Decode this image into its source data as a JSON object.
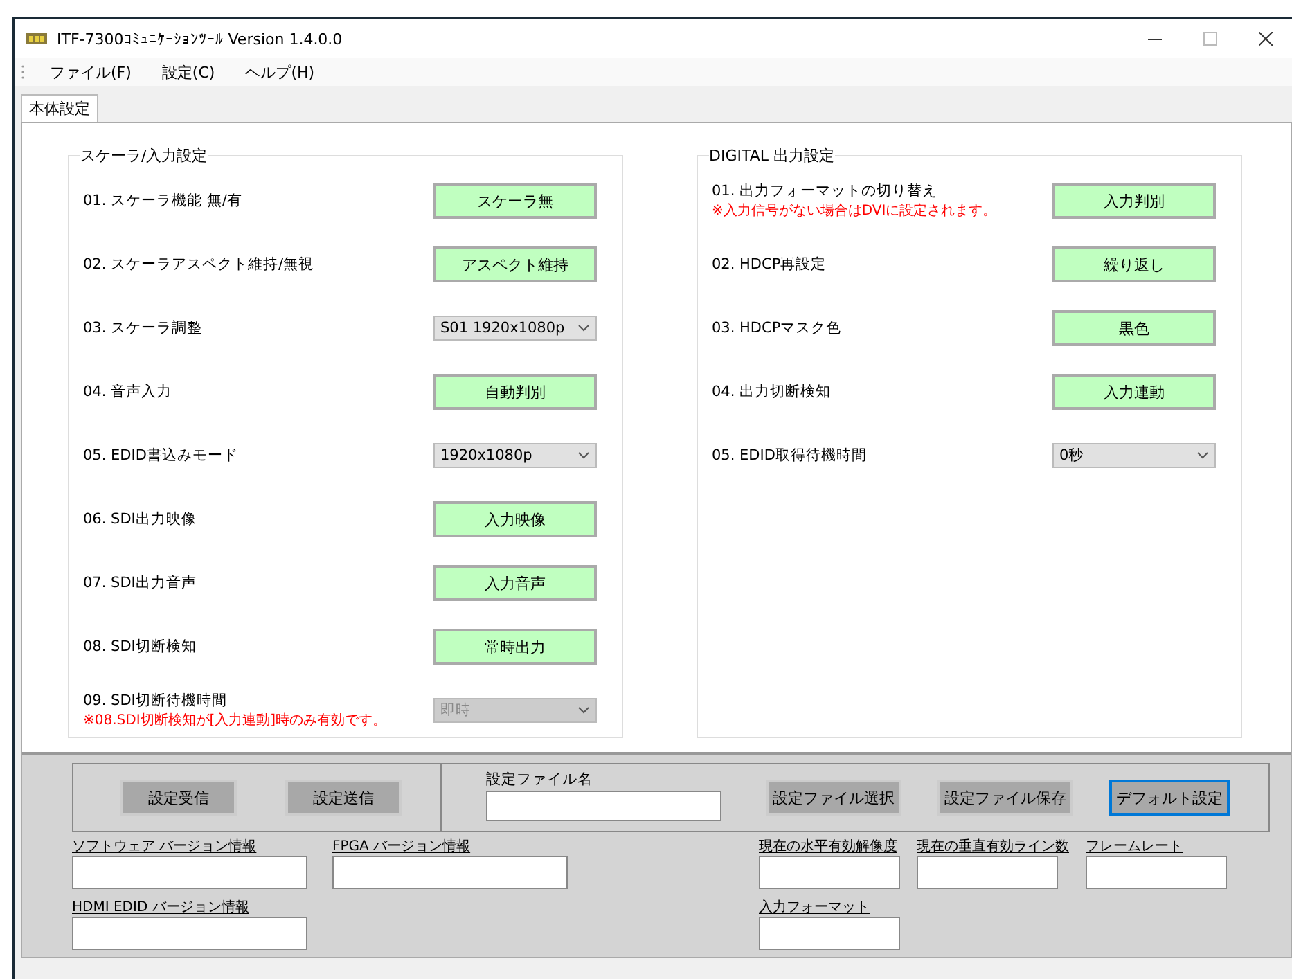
{
  "window": {
    "title": "ITF-7300ｺﾐｭﾆｹｰｼｮﾝﾂｰﾙ Version 1.4.0.0"
  },
  "menu": [
    {
      "label": "ファイル(F)"
    },
    {
      "label": "設定(C)"
    },
    {
      "label": "ヘルプ(H)"
    }
  ],
  "tabs": [
    {
      "label": "本体設定",
      "selected": true
    }
  ],
  "groups": [
    {
      "title": "スケーラ/入力設定",
      "rows": [
        {
          "label": "01. スケーラ機能 無/有",
          "control": {
            "kind": "button",
            "value": "スケーラ無"
          }
        },
        {
          "label": "02. スケーラアスペクト維持/無視",
          "control": {
            "kind": "button",
            "value": "アスペクト維持"
          }
        },
        {
          "label": "03. スケーラ調整",
          "control": {
            "kind": "dropdown",
            "value": "S01 1920x1080p",
            "disabled": false
          }
        },
        {
          "label": "04. 音声入力",
          "control": {
            "kind": "button",
            "value": "自動判別"
          }
        },
        {
          "label": "05. EDID書込みモード",
          "control": {
            "kind": "dropdown",
            "value": "1920x1080p",
            "disabled": false
          }
        },
        {
          "label": "06. SDI出力映像",
          "control": {
            "kind": "button",
            "value": "入力映像"
          }
        },
        {
          "label": "07. SDI出力音声",
          "control": {
            "kind": "button",
            "value": "入力音声"
          }
        },
        {
          "label": "08. SDI切断検知",
          "control": {
            "kind": "button",
            "value": "常時出力"
          }
        },
        {
          "label": "09. SDI切断待機時間",
          "note": "※08.SDI切断検知が[入力連動]時のみ有効です。",
          "control": {
            "kind": "dropdown",
            "value": "即時",
            "disabled": true
          }
        }
      ]
    },
    {
      "title": "DIGITAL 出力設定",
      "rows": [
        {
          "label": "01. 出力フォーマットの切り替え",
          "note": "※入力信号がない場合はDVIに設定されます。",
          "control": {
            "kind": "button",
            "value": "入力判別"
          }
        },
        {
          "label": "02. HDCP再設定",
          "control": {
            "kind": "button",
            "value": "繰り返し"
          }
        },
        {
          "label": "03. HDCPマスク色",
          "control": {
            "kind": "button",
            "value": "黒色"
          }
        },
        {
          "label": "04. 出力切断検知",
          "control": {
            "kind": "button",
            "value": "入力連動"
          }
        },
        {
          "label": "05. EDID取得待機時間",
          "control": {
            "kind": "dropdown",
            "value": "0秒",
            "disabled": false
          }
        }
      ]
    }
  ],
  "actions": {
    "left_buttons": [
      {
        "label": "設定受信",
        "focused": false
      },
      {
        "label": "設定送信",
        "focused": false
      }
    ],
    "file_name": {
      "label": "設定ファイル名"
    },
    "right_buttons": [
      {
        "label": "設定ファイル選択",
        "focused": false
      },
      {
        "label": "設定ファイル保存",
        "focused": false
      },
      {
        "label": "デフォルト設定",
        "focused": true
      }
    ]
  },
  "info_fields": [
    [
      {
        "label": "ソフトウェア バージョン情報"
      },
      {
        "label": "FPGA バージョン情報"
      },
      {
        "label": "現在の水平有効解像度"
      },
      {
        "label": "現在の垂直有効ライン数"
      },
      {
        "label": "フレームレート"
      }
    ],
    [
      {
        "label": "HDMI EDID バージョン情報"
      },
      {
        "label": "入力フォーマット"
      }
    ]
  ]
}
